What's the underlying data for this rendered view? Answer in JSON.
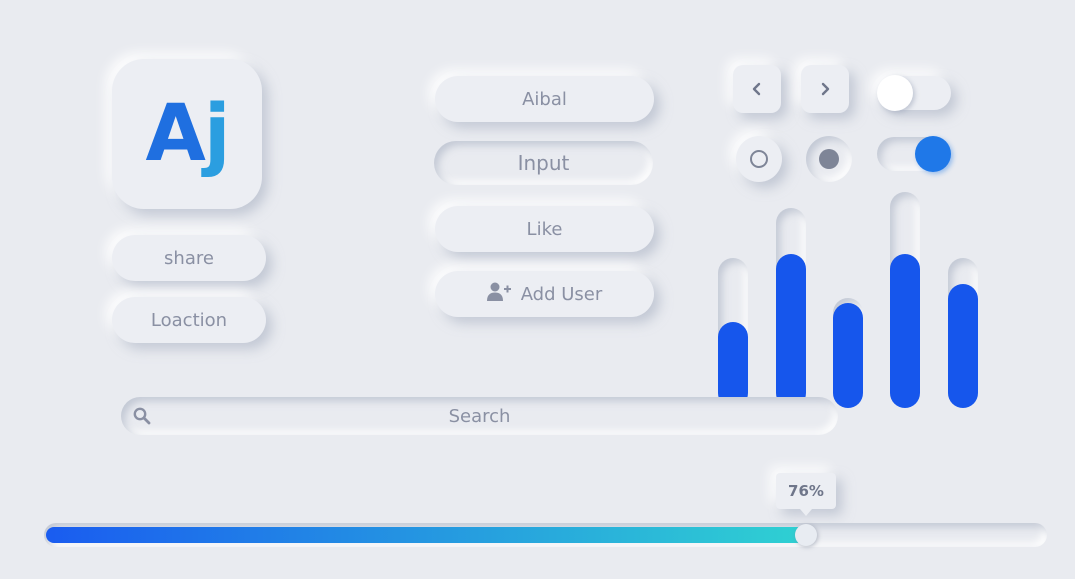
{
  "logo": {
    "letter_a": "A",
    "letter_j": "j"
  },
  "buttons": {
    "share": "share",
    "location": "Loaction",
    "aibal": "Aibal",
    "like": "Like",
    "add_user": "Add User",
    "prev_icon": "chevron-left-icon",
    "next_icon": "chevron-right-icon"
  },
  "input": {
    "placeholder": "Input"
  },
  "search": {
    "placeholder": "Search",
    "icon": "search-icon"
  },
  "toggles": [
    {
      "state": "off"
    },
    {
      "state": "on"
    }
  ],
  "radios": [
    {
      "state": "unselected"
    },
    {
      "state": "selected"
    }
  ],
  "colors": {
    "accent": "#1656ec",
    "toggle_on": "#1f78e8",
    "logo_a": "#1f6fe0",
    "logo_j": "#2b9ee0",
    "gradient_start": "#1a5cf0",
    "gradient_end": "#2fd1d2"
  },
  "chart_data": {
    "type": "bar",
    "values": [
      0.45,
      0.81,
      0.55,
      0.81,
      0.65
    ],
    "ylim": [
      0,
      1
    ],
    "grid": false
  },
  "progress": {
    "value": 76,
    "label": "76%"
  }
}
